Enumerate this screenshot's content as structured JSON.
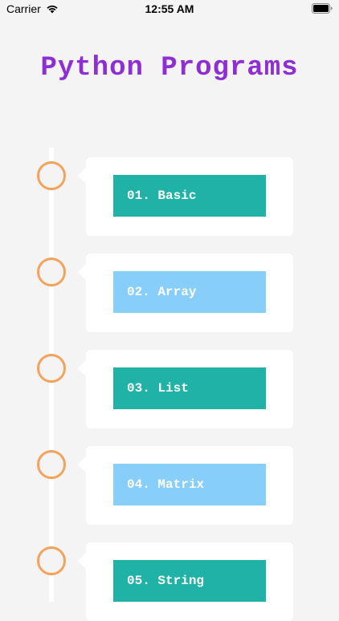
{
  "status_bar": {
    "carrier": "Carrier",
    "time": "12:55 AM",
    "wifi_icon": "wifi-icon",
    "battery_icon": "battery-icon"
  },
  "title": "Python Programs",
  "colors": {
    "title": "#8e2fd6",
    "node_border": "#f3a35a",
    "teal": "#20b2a7",
    "light_blue": "#87cefa",
    "background": "#f4f4f4"
  },
  "items": [
    {
      "label": "01. Basic",
      "color": "#20b2a7"
    },
    {
      "label": "02. Array",
      "color": "#87cefa"
    },
    {
      "label": "03. List",
      "color": "#20b2a7"
    },
    {
      "label": "04. Matrix",
      "color": "#87cefa"
    },
    {
      "label": "05. String",
      "color": "#20b2a7"
    }
  ]
}
